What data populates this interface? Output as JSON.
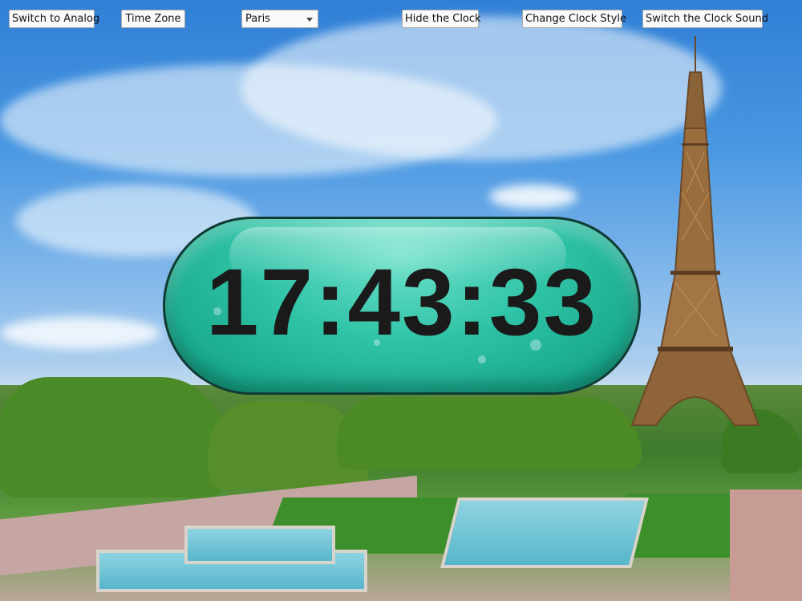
{
  "toolbar": {
    "switch_analog_label": "Switch to Analog",
    "time_zone_label": "Time Zone",
    "timezone_select_value": "Paris",
    "hide_clock_label": "Hide the Clock",
    "change_style_label": "Change Clock Style",
    "switch_sound_label": "Switch the Clock Sound"
  },
  "clock": {
    "time": "17:43:33",
    "face_color": "#2fc3a6",
    "text_color": "#1a1a1a"
  },
  "background": {
    "sky_color": "#4a98e2",
    "landmark_icon": "eiffel-tower-icon"
  }
}
